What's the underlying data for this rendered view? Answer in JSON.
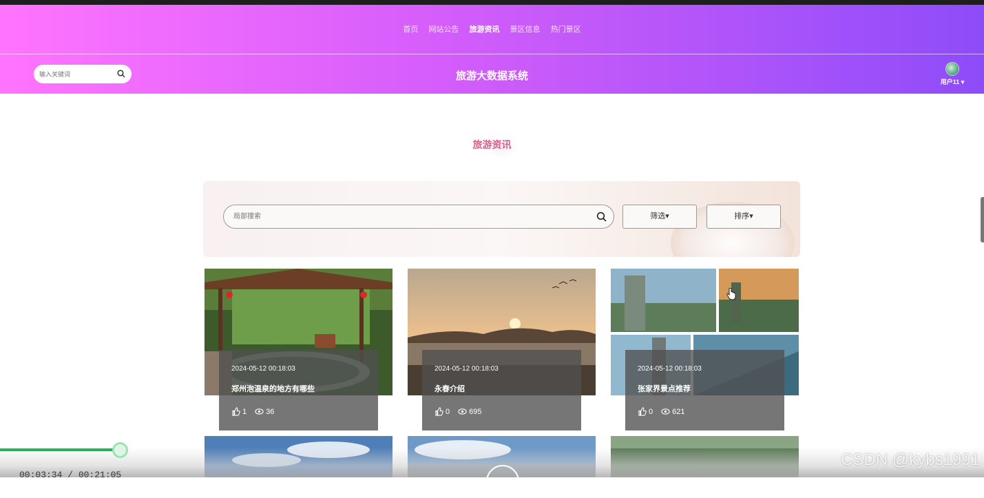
{
  "nav": {
    "items": [
      {
        "label": "首页"
      },
      {
        "label": "网站公告"
      },
      {
        "label": "旅游资讯",
        "active": true
      },
      {
        "label": "景区信息"
      },
      {
        "label": "热门景区"
      }
    ]
  },
  "header": {
    "search_placeholder": "输入关键词",
    "system_title": "旅游大数据系统",
    "user_name": "用户11"
  },
  "section": {
    "title": "旅游资讯"
  },
  "filters": {
    "local_search_placeholder": "局部搜索",
    "filter_label": "筛选▾",
    "sort_label": "排序▾"
  },
  "cards": [
    {
      "date": "2024-05-12 00:18:03",
      "title": "郑州泡温泉的地方有哪些",
      "likes": "1",
      "views": "36"
    },
    {
      "date": "2024-05-12 00:18:03",
      "title": "永春介绍",
      "likes": "0",
      "views": "695"
    },
    {
      "date": "2024-05-12 00:18:03",
      "title": "张家界景点推荐",
      "likes": "0",
      "views": "621"
    }
  ],
  "player": {
    "time": "00:03:34 / 00:21:05",
    "progress": 0.17,
    "watermark": "CSDN @kybs1991"
  },
  "colors": {
    "header_start": "#ff74ff",
    "header_end": "#8e4cf9",
    "section_title": "#e35a8c",
    "progress": "#27b25a"
  }
}
